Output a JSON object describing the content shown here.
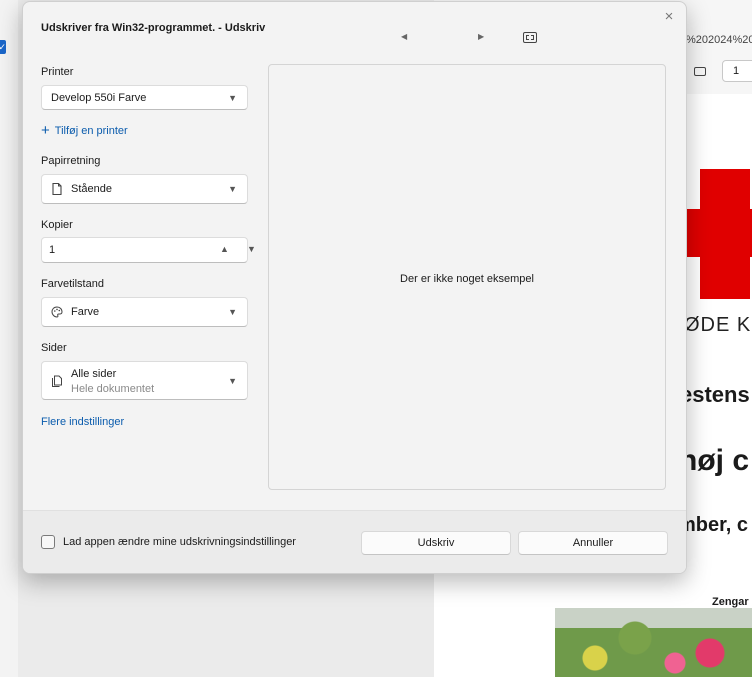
{
  "background_app": {
    "address_text": "%202024%20",
    "page_number": "1",
    "doc_org_text": "ØDE KO",
    "doc_heading1": "estens",
    "doc_heading2": "nøj c",
    "doc_heading3": "mber, c",
    "doc_caption": "Zengar",
    "cross_color": "#e00000"
  },
  "dialog": {
    "title": "Udskriver fra Win32-programmet. - Udskriv",
    "close_icon": "×",
    "prev_icon": "◀",
    "next_icon": "▶",
    "printer": {
      "label": "Printer",
      "value": "Develop 550i Farve",
      "add_label": "Tilføj en printer",
      "add_icon": "+"
    },
    "orientation": {
      "label": "Papirretning",
      "value": "Stående",
      "icon": "page-icon"
    },
    "copies": {
      "label": "Kopier",
      "value": "1",
      "up_icon": "▲",
      "down_icon": "▼"
    },
    "color_mode": {
      "label": "Farvetilstand",
      "value": "Farve",
      "icon": "palette-icon"
    },
    "pages": {
      "label": "Sider",
      "value": "Alle sider",
      "sub_value": "Hele dokumentet",
      "icon": "pages-icon"
    },
    "more_settings_label": "Flere indstillinger",
    "chevron_icon": "▼",
    "preview": {
      "empty_text": "Der er ikke noget eksempel"
    },
    "footer": {
      "checkbox_label": "Lad appen ændre mine udskrivningsindstillinger",
      "checkbox_checked": false,
      "print_label": "Udskriv",
      "cancel_label": "Annuller"
    }
  }
}
